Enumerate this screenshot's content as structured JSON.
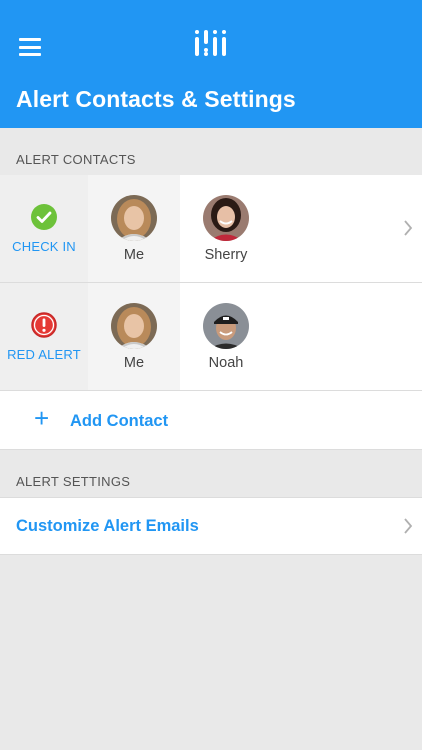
{
  "header": {
    "title": "Alert Contacts & Settings",
    "bg_color": "#2196f3",
    "menu_icon": "hamburger-menu-icon",
    "logo_icon": "app-logo-icon"
  },
  "alert_contacts": {
    "section_label": "ALERT CONTACTS",
    "rows": [
      {
        "type_label": "CHECK IN",
        "type_icon": "check-circle-icon",
        "type_color": "#6dc23a",
        "contacts": [
          {
            "name": "Me"
          },
          {
            "name": "Sherry"
          }
        ]
      },
      {
        "type_label": "RED ALERT",
        "type_icon": "exclamation-circle-icon",
        "type_color": "#e53935",
        "contacts": [
          {
            "name": "Me"
          },
          {
            "name": "Noah"
          }
        ]
      }
    ],
    "add_contact": {
      "icon": "+",
      "label": "Add Contact"
    }
  },
  "alert_settings": {
    "section_label": "ALERT SETTINGS",
    "items": [
      {
        "label": "Customize Alert Emails"
      }
    ]
  },
  "accent_color": "#2196f3"
}
